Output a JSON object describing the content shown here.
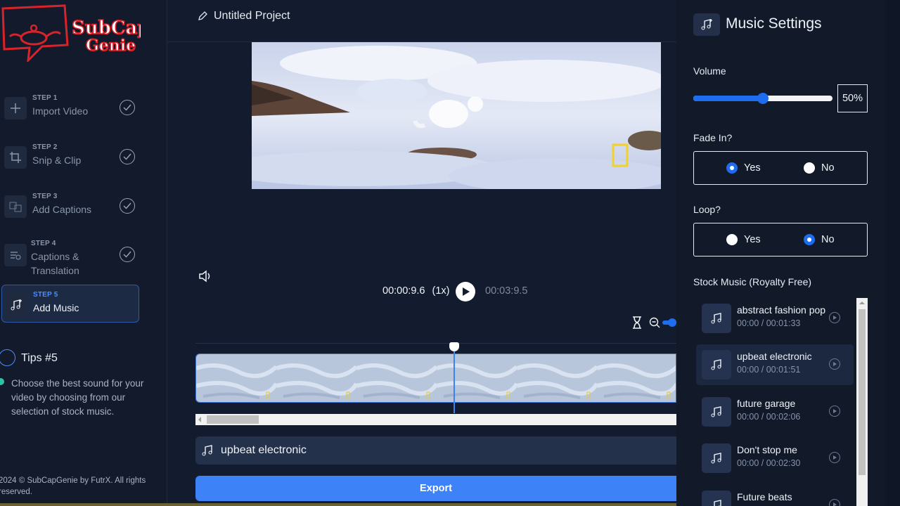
{
  "sidebar": {
    "logo_text": "SubCap Genie",
    "steps": [
      {
        "num": "STEP 1",
        "label": "Import Video",
        "icon": "plus-icon"
      },
      {
        "num": "STEP 2",
        "label": "Snip & Clip",
        "icon": "crop-icon"
      },
      {
        "num": "STEP 3",
        "label": "Add Captions",
        "icon": "captions-icon"
      },
      {
        "num": "STEP 4",
        "label": "Captions & Translation",
        "icon": "translate-icon"
      },
      {
        "num": "STEP 5",
        "label": "Add Music",
        "icon": "music-add-icon"
      }
    ],
    "tips_title": "Tips #5",
    "tips_text": "Choose the best sound for your video by choosing from our selection of stock music.",
    "copyright": "2024 © SubCapGenie by FutrX. All rights reserved."
  },
  "main": {
    "project_title": "Untitled Project",
    "current_time": "00:00:9.6",
    "speed": "(1x)",
    "total_time": "00:03:9.5",
    "music_track": "upbeat electronic",
    "export_label": "Export"
  },
  "panel": {
    "title": "Music Settings",
    "volume_label": "Volume",
    "volume_value": "50%",
    "volume_fraction": 0.5,
    "fade_label": "Fade In?",
    "fade_selected": "Yes",
    "loop_label": "Loop?",
    "loop_selected": "No",
    "yes_label": "Yes",
    "no_label": "No",
    "stock_label": "Stock Music (Royalty Free)",
    "songs": [
      {
        "name": "abstract fashion pop",
        "time": "00:00 / 00:01:33"
      },
      {
        "name": "upbeat electronic",
        "time": "00:00 / 00:01:51"
      },
      {
        "name": "future garage",
        "time": "00:00 / 00:02:06"
      },
      {
        "name": "Don't stop me",
        "time": "00:00 / 00:02:30"
      },
      {
        "name": "Future beats",
        "time": ""
      }
    ]
  },
  "colors": {
    "accent": "#3e82f7",
    "background": "#131c2e",
    "panel": "#121a2a"
  }
}
